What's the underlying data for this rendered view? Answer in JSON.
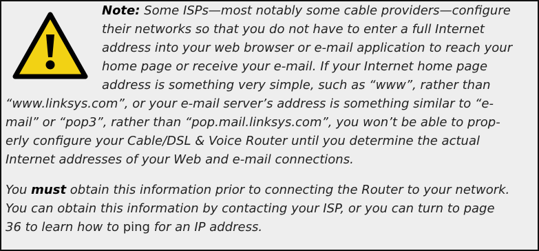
{
  "note": {
    "icon": "warning-triangle-icon",
    "colors": {
      "background": "#eeeeee",
      "border": "#111111",
      "text": "#222222",
      "icon_fill": "#f2d214",
      "icon_outline": "#000000"
    },
    "lead_label": "Note:",
    "p1_l1": " Some ISPs—most notably some cable providers—configure",
    "p1_l2": "their networks so that you do not have to enter a full Internet",
    "p1_l3": "address into your web browser or e-mail application to reach your",
    "p1_l4": "home page or receive your e-mail. If your Internet home page",
    "p1_l5": "address is something very simple, such as “www”, rather than",
    "p1_l6": "“www.linksys.com”, or your e-mail server’s address is something similar to “e-",
    "p1_l7": "mail” or “pop3”, rather than “pop.mail.linksys.com”, you won’t be able to prop-",
    "p1_l8": "erly configure your Cable/DSL & Voice Router until you determine the actual",
    "p1_l9": "Internet addresses of your Web and e-mail connections.",
    "p2_l1_a": "You ",
    "p2_l1_b": "must",
    "p2_l1_c": " obtain this information prior to connecting the Router to your network.",
    "p2_l2": "You can obtain this information by contacting your ISP, or you can turn to page",
    "p2_l3_a": "36 to learn how to ",
    "p2_l3_b": "ping",
    "p2_l3_c": " for an IP address."
  }
}
